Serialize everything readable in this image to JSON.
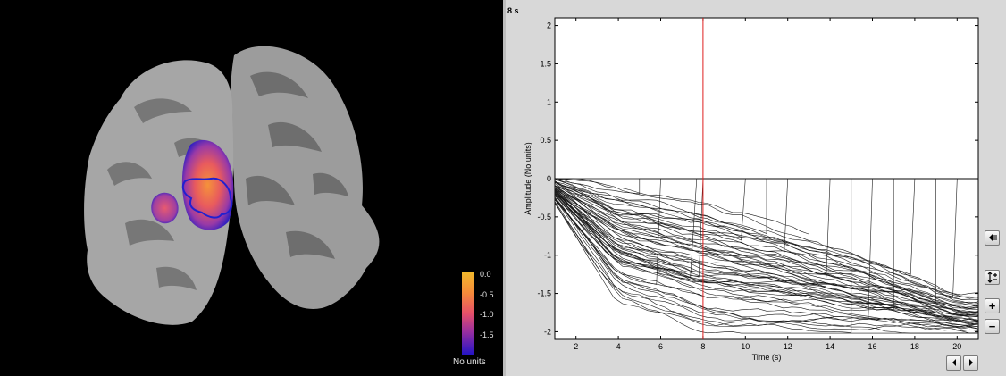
{
  "brain_view": {
    "colorbar": {
      "ticks": [
        "0.0",
        "-0.5",
        "-1.0",
        "-1.5"
      ],
      "units": "No units",
      "colors": [
        "#f2b82c",
        "#f58a3a",
        "#e6506a",
        "#9a2fa0",
        "#2414c4"
      ]
    },
    "scout_color": "#2020d0"
  },
  "time_series": {
    "current_time_label": "8 s",
    "controls": [
      "collapse-icon",
      "autoscale-icon",
      "zoom-in-icon",
      "zoom-out-icon",
      "scroll-left-icon",
      "scroll-right-icon"
    ],
    "plus_label": "+",
    "minus_label": "−"
  },
  "chart_data": {
    "type": "line",
    "xlabel": "Time (s)",
    "ylabel": "Amplitude (No units)",
    "xlim": [
      1,
      21
    ],
    "ylim": [
      -2.1,
      2.1
    ],
    "xticks": [
      2,
      4,
      6,
      8,
      10,
      12,
      14,
      16,
      18,
      20
    ],
    "yticks": [
      2,
      1.5,
      1,
      0.5,
      0,
      -0.5,
      -1,
      -1.5,
      -2
    ],
    "cursor_x": 8,
    "cursor_color": "#e02020",
    "line_color": "#1a1a1a",
    "reset_times": [
      5,
      6,
      7.7,
      8,
      10,
      11,
      12,
      13,
      14,
      15,
      16,
      17,
      18,
      19,
      20
    ],
    "series_count": 60,
    "envelope": {
      "x": [
        1,
        4,
        8,
        12,
        16,
        20
      ],
      "upper": [
        0.0,
        -0.2,
        -0.4,
        -0.7,
        -1.1,
        -1.6
      ],
      "lower": [
        -0.3,
        -1.5,
        -1.9,
        -1.95,
        -1.98,
        -2.0
      ]
    }
  }
}
